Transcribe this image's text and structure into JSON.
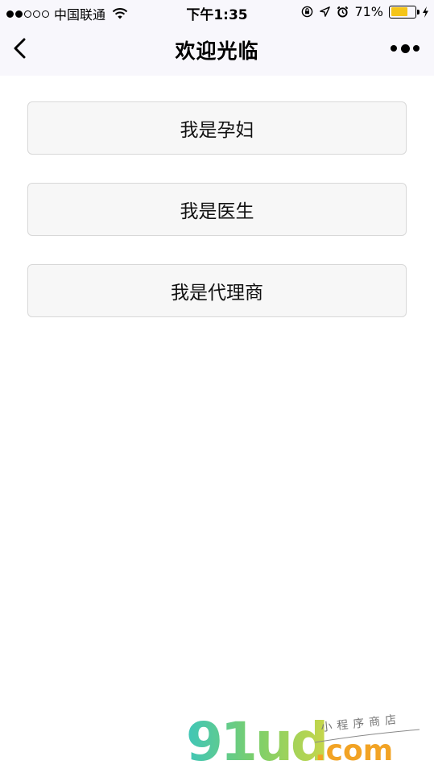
{
  "status_bar": {
    "carrier": "中国联通",
    "time": "下午1:35",
    "battery_percent": "71%",
    "battery_level": 0.71,
    "signal_filled": 2,
    "signal_total": 5
  },
  "nav": {
    "title": "欢迎光临",
    "back_icon": "chevron-left-icon",
    "more_icon": "more-dots-icon"
  },
  "roles": [
    {
      "label": "我是孕妇"
    },
    {
      "label": "我是医生"
    },
    {
      "label": "我是代理商"
    }
  ],
  "watermark": {
    "logo": "91ud",
    "domain": ".com",
    "tagline": "小程序商店"
  },
  "colors": {
    "bar_background": "#f8f7fc",
    "button_background": "#f7f7f7",
    "button_border": "#d8d8d8",
    "battery_fill": "#f5c518"
  }
}
